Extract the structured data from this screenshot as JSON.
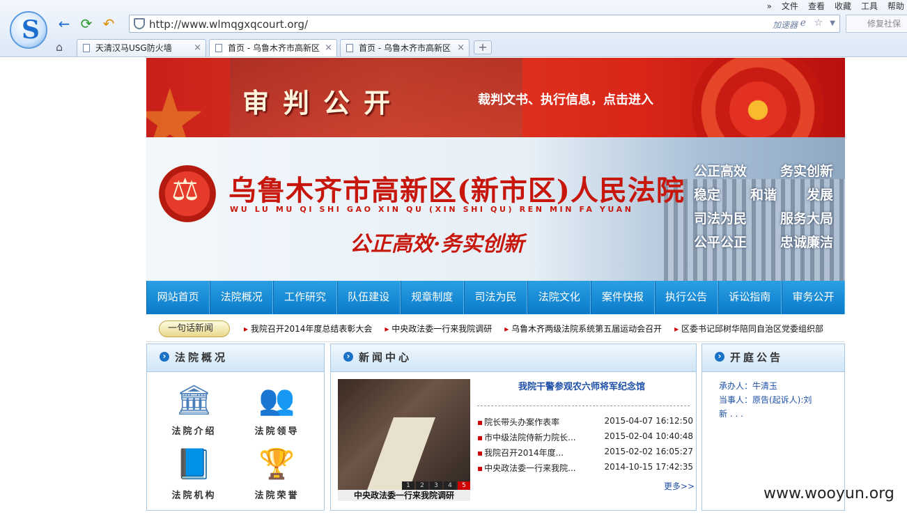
{
  "browser": {
    "menu": [
      "»",
      "文件",
      "查看",
      "收藏",
      "工具",
      "帮助"
    ],
    "url": "http://www.wlmqgxqcourt.org/",
    "accelerator": "加速器",
    "restore": "修复社保",
    "tabs": [
      {
        "label": "天清汉马USG防火墙"
      },
      {
        "label": "首页 - 乌鲁木齐市高新区"
      },
      {
        "label": "首页 - 乌鲁木齐市高新区"
      }
    ]
  },
  "banner_top": {
    "title": "审判公开",
    "subtitle": "裁判文书、执行信息，点击进入"
  },
  "banner_main": {
    "name": "乌鲁木齐市高新区(新市区)人民法院",
    "pinyin": "WU LU MU QI SHI GAO XIN QU (XIN SHI QU) REN MIN FA YUAN",
    "motto": "公正高效·务实创新",
    "slogans": [
      [
        "公正高效",
        "务实创新"
      ],
      [
        "稳定",
        "和谐",
        "发展"
      ],
      [
        "司法为民",
        "服务大局"
      ],
      [
        "公平公正",
        "忠诚廉洁"
      ]
    ]
  },
  "nav": [
    "网站首页",
    "法院概况",
    "工作研究",
    "队伍建设",
    "规章制度",
    "司法为民",
    "法院文化",
    "案件快报",
    "执行公告",
    "诉讼指南",
    "审务公开"
  ],
  "ticker": {
    "label": "一句话新闻",
    "items": [
      "我院召开2014年度总结表彰大会",
      "中央政法委一行来我院调研",
      "乌鲁木齐两级法院系统第五届运动会召开",
      "区委书记邱树华陪同自治区党委组织部"
    ]
  },
  "overview": {
    "title": "法院概况",
    "items": [
      "法院介绍",
      "法院领导",
      "法院机构",
      "法院荣誉"
    ]
  },
  "news_center": {
    "title": "新闻中心",
    "headline": "我院干警参观农六师将军纪念馆",
    "photo_caption": "中央政法委一行来我院调研",
    "pages": [
      "1",
      "2",
      "3",
      "4",
      "5"
    ],
    "items": [
      {
        "title": "院长带头办案作表率",
        "date": "2015-04-07 16:12:50"
      },
      {
        "title": "市中级法院侍新力院长...",
        "date": "2015-02-04 10:40:48"
      },
      {
        "title": "我院召开2014年度...",
        "date": "2015-02-02 16:05:27"
      },
      {
        "title": "中央政法委一行来我院...",
        "date": "2014-10-15 17:42:35"
      }
    ],
    "more": "更多>>"
  },
  "court_notice": {
    "title": "开庭公告",
    "lines": [
      "承办人：牛清玉",
      "当事人：原告(起诉人):刘",
      "新 . . ."
    ]
  },
  "watermark": "www.wooyun.org"
}
